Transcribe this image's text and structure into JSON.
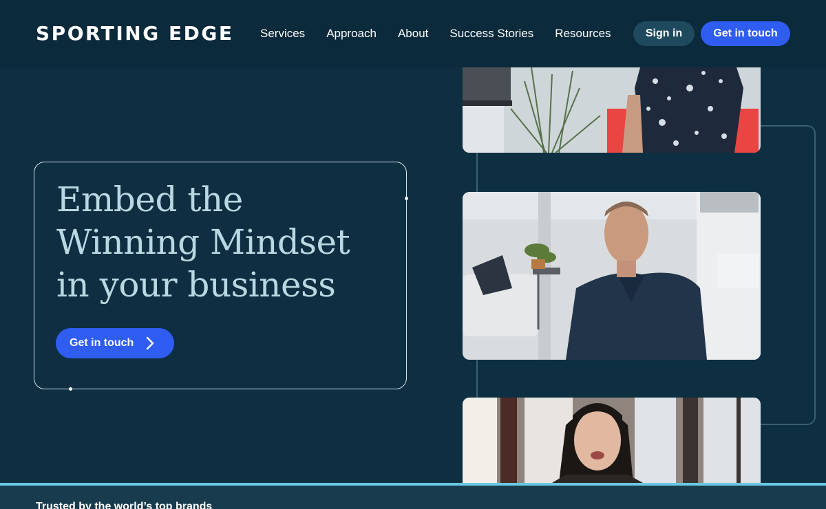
{
  "brand": {
    "logo_text": "SPORTING EDGE"
  },
  "nav": {
    "items": [
      {
        "label": "Services"
      },
      {
        "label": "Approach"
      },
      {
        "label": "About"
      },
      {
        "label": "Success Stories"
      },
      {
        "label": "Resources"
      }
    ],
    "sign_in_label": "Sign in",
    "cta_label": "Get in touch"
  },
  "hero": {
    "headline": "Embed the Winning Mindset in your business",
    "cta_label": "Get in touch",
    "cta_icon": "chevron-right-icon"
  },
  "footer": {
    "trusted_text": "Trusted by the world’s top brands"
  },
  "colors": {
    "background": "#0e2f42",
    "header": "#0b2a3b",
    "accent_blue": "#2f5df2",
    "headline_text": "#b8d8e2",
    "footer_strip": "#6bc7e3"
  }
}
